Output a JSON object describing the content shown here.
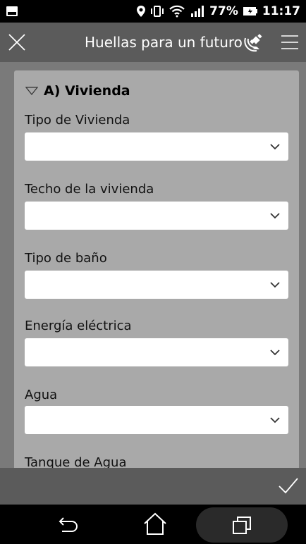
{
  "status_bar": {
    "battery": "77%",
    "time": "11:17",
    "icons": [
      "notification-icon",
      "location-icon",
      "vibrate-icon",
      "wifi-icon",
      "signal-icon",
      "battery-icon"
    ]
  },
  "app_bar": {
    "title": "Huellas para un futuro",
    "icons": [
      "close-icon",
      "gps-icon",
      "menu-icon"
    ]
  },
  "section": {
    "title": "A) Vivienda",
    "icon": "collapse-triangle-icon"
  },
  "fields": [
    {
      "label": "Tipo de Vivienda",
      "value": ""
    },
    {
      "label": "Techo de la vivienda",
      "value": ""
    },
    {
      "label": "Tipo de baño",
      "value": ""
    },
    {
      "label": "Energía eléctrica",
      "value": ""
    },
    {
      "label": "Agua",
      "value": ""
    },
    {
      "label": "Tanque de Agua",
      "value": ""
    }
  ],
  "action_bar": {
    "icons": [
      "check-icon"
    ]
  },
  "nav_bar": {
    "icons": [
      "back-icon",
      "home-icon",
      "recent-apps-icon"
    ]
  },
  "colors": {
    "app_bar": "#5b5b5b",
    "content_bg": "#7a7a7a",
    "card_bg": "#a9a9a9"
  }
}
